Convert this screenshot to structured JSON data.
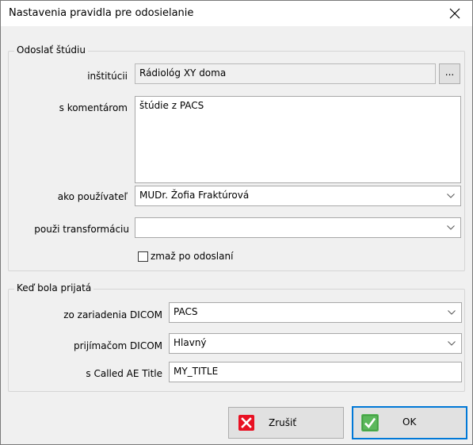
{
  "window": {
    "title": "Nastavenia pravidla pre odosielanie",
    "close_glyph": "✕"
  },
  "send_group": {
    "title": "Odoslať štúdiu",
    "institution_label": "inštitúcii",
    "institution_value": "Rádiológ XY doma",
    "browse_label": "...",
    "comment_label": "s komentárom",
    "comment_value": "štúdie z PACS",
    "user_label": "ako používateľ",
    "user_value": "MUDr. Žofia Fraktúrová",
    "transform_label": "použi transformáciu",
    "transform_value": "",
    "delete_after_label": "zmaž po odoslaní",
    "delete_after_checked": false
  },
  "received_group": {
    "title": "Keď bola prijatá",
    "device_label": "zo zariadenia DICOM",
    "device_value": "PACS",
    "receiver_label": "prijímačom DICOM",
    "receiver_value": "Hlavný",
    "called_ae_label": "s Called AE Title",
    "called_ae_value": "MY_TITLE"
  },
  "buttons": {
    "cancel_label": "Zrušiť",
    "ok_label": "OK"
  },
  "colors": {
    "accent": "#0078d7",
    "cancel_icon": "#e81123",
    "ok_icon": "#5cb85c"
  }
}
